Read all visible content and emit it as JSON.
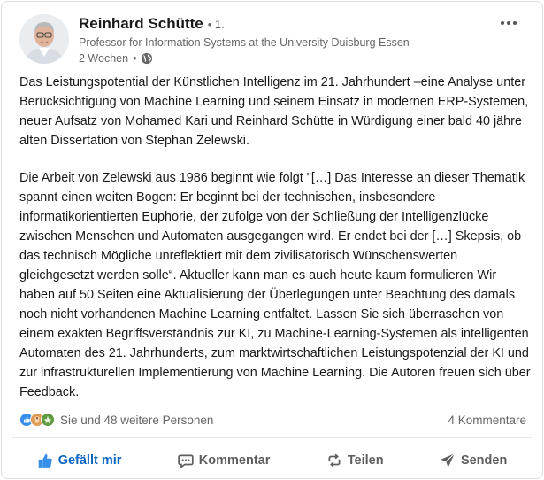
{
  "author": {
    "name": "Reinhard Schütte",
    "degree": "• 1.",
    "headline": "Professor for Information Systems at the University Duisburg Essen",
    "time": "2 Wochen",
    "separator": "•"
  },
  "post": {
    "paragraphs": [
      "Das Leistungspotential der Künstlichen Intelligenz im 21. Jahrhundert –eine Analyse unter Berücksichtigung von Machine Learning und seinem Einsatz in modernen ERP-Systemen, neuer Aufsatz von Mohamed Kari und Reinhard Schütte in Würdigung einer bald 40 jähre alten Dissertation von Stephan Zelewski.",
      "Die Arbeit von Zelewski aus 1986 beginnt wie folgt \"[…] Das Interesse an dieser Thematik spannt einen weiten Bogen: Er beginnt bei der technischen, insbesondere informatikorientierten Euphorie, der zufolge von der Schließung der Intelligenzlücke zwischen Menschen und Automaten ausgegangen wird. Er endet bei der […] Skepsis, ob das technisch Mögliche unreflektiert mit dem zivilisatorisch Wünschenswerten gleichgesetzt werden solle“. Aktueller kann man es auch heute kaum formulieren Wir haben auf 50 Seiten eine Aktualisierung der Überlegungen unter Beachtung des damals noch nicht vorhandenen Machine Learning entfaltet. Lassen Sie sich überraschen von einem exakten Begriffsverständnis zur KI, zu Machine-Learning-Systemen als intelligenten Automaten des 21. Jahrhunderts, zum marktwirtschaftlichen Leistungspotenzial der KI und zur infrastrukturellen Implementierung von Machine Learning. Die Autoren freuen sich über Feedback."
    ]
  },
  "social": {
    "reactions_text": "Sie und 48 weitere Personen",
    "comments_text": "4 Kommentare",
    "reaction_icons": [
      "like-reaction-icon",
      "celebrate-reaction-icon",
      "insightful-reaction-icon"
    ]
  },
  "actions": {
    "like": "Gefällt mir",
    "comment": "Kommentar",
    "repost": "Teilen",
    "send": "Senden"
  },
  "colors": {
    "accent": "#0a66c2",
    "muted": "#666666"
  }
}
